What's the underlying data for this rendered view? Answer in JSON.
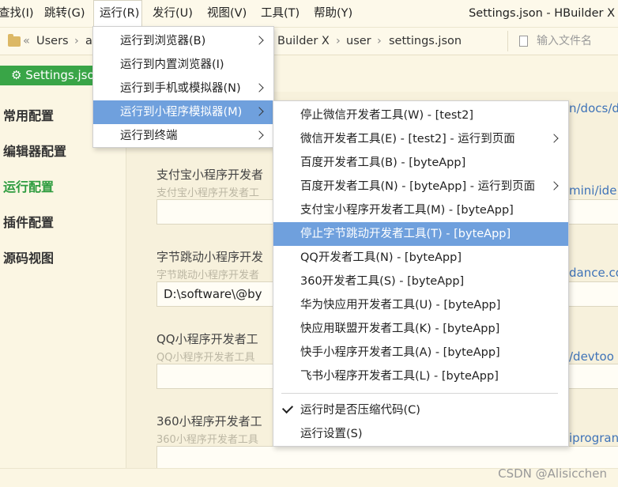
{
  "menubar": {
    "items": [
      "查找(I)",
      "跳转(G)",
      "运行(R)",
      "发行(U)",
      "视图(V)",
      "工具(T)",
      "帮助(Y)"
    ],
    "window_title": "Settings.json - HBuilder X"
  },
  "pathbar": {
    "prefix": "«",
    "crumbs": [
      "Users",
      "a",
      "Builder X",
      "user",
      "settings.json"
    ],
    "file_input_placeholder": "输入文件名"
  },
  "tab": {
    "label": "⚙ Settings.json"
  },
  "leftnav": {
    "items": [
      "常用配置",
      "编辑器配置",
      "运行配置",
      "插件配置",
      "源码视图"
    ],
    "active_index": 2
  },
  "content": {
    "settings": [
      {
        "label": "支付宝小程序开发者",
        "hint": "支付宝小程序开发者工",
        "value": "",
        "link": "mini/ide"
      },
      {
        "label": "字节跳动小程序开发",
        "hint": "字节跳动小程序开发者",
        "value": "D:\\software\\@by",
        "link": "dance.co"
      },
      {
        "label": "QQ小程序开发者工",
        "hint": "QQ小程序开发者工具",
        "value": "",
        "link": "/devtoo"
      },
      {
        "label": "360小程序开发者工",
        "hint": "360小程序开发者工具",
        "value": "",
        "link": "iprogran"
      }
    ],
    "top_link": "n/docs/d"
  },
  "run_menu": {
    "items": [
      {
        "label": "运行到浏览器(B)",
        "submenu": true
      },
      {
        "label": "运行到内置浏览器(I)",
        "submenu": false
      },
      {
        "label": "运行到手机或模拟器(N)",
        "submenu": true
      },
      {
        "label": "运行到小程序模拟器(M)",
        "submenu": true
      },
      {
        "label": "运行到终端",
        "submenu": true
      }
    ],
    "highlighted_index": 3
  },
  "miniprogram_menu": {
    "items": [
      {
        "label": "停止微信开发者工具(W) - [test2]",
        "submenu": false
      },
      {
        "label": "微信开发者工具(E) - [test2] - 运行到页面",
        "submenu": true
      },
      {
        "label": "百度开发者工具(B) - [byteApp]",
        "submenu": false
      },
      {
        "label": "百度开发者工具(N) - [byteApp] - 运行到页面",
        "submenu": true
      },
      {
        "label": "支付宝小程序开发者工具(M) - [byteApp]",
        "submenu": false
      },
      {
        "label": "停止字节跳动开发者工具(T) - [byteApp]",
        "submenu": false
      },
      {
        "label": "QQ开发者工具(N) - [byteApp]",
        "submenu": false
      },
      {
        "label": "360开发者工具(S) - [byteApp]",
        "submenu": false
      },
      {
        "label": "华为快应用开发者工具(U) - [byteApp]",
        "submenu": false
      },
      {
        "label": "快应用联盟开发者工具(K) - [byteApp]",
        "submenu": false
      },
      {
        "label": "快手小程序开发者工具(A) - [byteApp]",
        "submenu": false
      },
      {
        "label": "飞书小程序开发者工具(L) - [byteApp]",
        "submenu": false
      }
    ],
    "highlighted_index": 5,
    "compress_option": {
      "label": "运行时是否压缩代码(C)",
      "checked": true
    },
    "run_settings": "运行设置(S)"
  },
  "watermark": "CSDN @Alisicchen",
  "colors": {
    "accent_green": "#39a547",
    "menu_highlight": "#6fa0dd",
    "link_blue": "#3f73b8"
  }
}
